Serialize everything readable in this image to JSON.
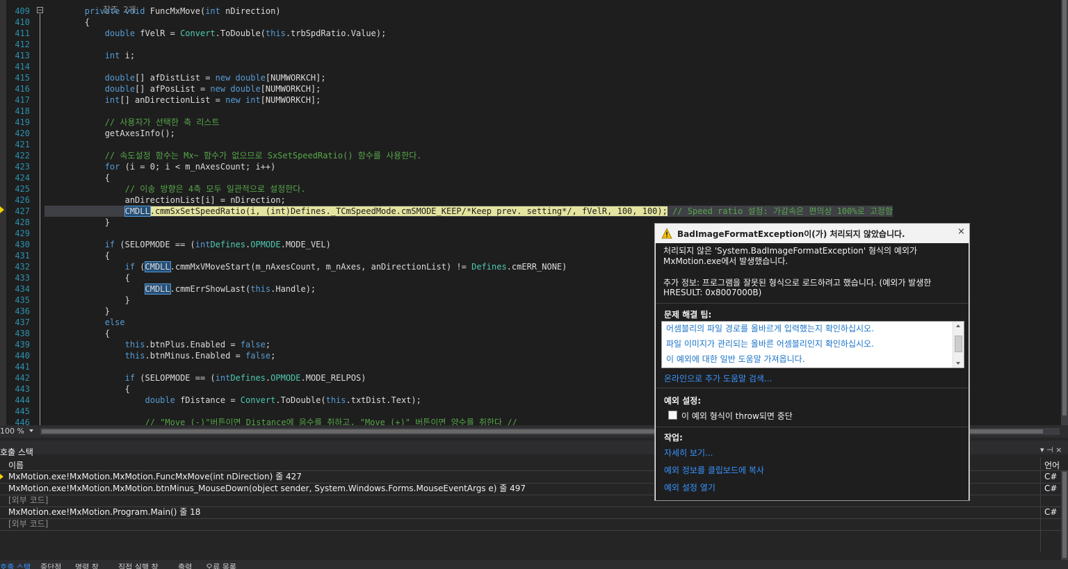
{
  "editor": {
    "lines": [
      {
        "num": "409",
        "segs": [
          [
            "kw",
            "        private void "
          ],
          [
            "",
            "FuncMxMove("
          ],
          [
            "kw",
            "int"
          ],
          [
            "",
            " nDirection)"
          ]
        ]
      },
      {
        "num": "410",
        "segs": [
          [
            "",
            "        {"
          ]
        ]
      },
      {
        "num": "411",
        "segs": [
          [
            "kw",
            "            double"
          ],
          [
            "",
            " fVelR = "
          ],
          [
            "ty",
            "Convert"
          ],
          [
            "",
            ".ToDouble("
          ],
          [
            "kw",
            "this"
          ],
          [
            "",
            ".trbSpdRatio.Value);"
          ]
        ]
      },
      {
        "num": "412",
        "segs": []
      },
      {
        "num": "413",
        "segs": [
          [
            "kw",
            "            int"
          ],
          [
            "",
            " i;"
          ]
        ]
      },
      {
        "num": "414",
        "segs": []
      },
      {
        "num": "415",
        "segs": [
          [
            "kw",
            "            double"
          ],
          [
            "",
            "[] afDistList = "
          ],
          [
            "kw",
            "new double"
          ],
          [
            "",
            "[NUMWORKCH];"
          ]
        ]
      },
      {
        "num": "416",
        "segs": [
          [
            "kw",
            "            double"
          ],
          [
            "",
            "[] afPosList = "
          ],
          [
            "kw",
            "new double"
          ],
          [
            "",
            "[NUMWORKCH];"
          ]
        ]
      },
      {
        "num": "417",
        "segs": [
          [
            "kw",
            "            int"
          ],
          [
            "",
            "[] anDirectionList = "
          ],
          [
            "kw",
            "new int"
          ],
          [
            "",
            "[NUMWORKCH];"
          ]
        ]
      },
      {
        "num": "418",
        "segs": []
      },
      {
        "num": "419",
        "segs": [
          [
            "cm",
            "            // 사용자가 선택한 축 리스트"
          ]
        ]
      },
      {
        "num": "420",
        "segs": [
          [
            "",
            "            getAxesInfo();"
          ]
        ]
      },
      {
        "num": "421",
        "segs": []
      },
      {
        "num": "422",
        "segs": [
          [
            "cm",
            "            // 속도설정 함수는 Mx~ 함수가 없으므로 SxSetSpeedRatio() 함수를 사용한다."
          ]
        ]
      },
      {
        "num": "423",
        "segs": [
          [
            "kw",
            "            for"
          ],
          [
            "",
            " (i = 0; i < m_nAxesCount; i++)"
          ]
        ]
      },
      {
        "num": "424",
        "segs": [
          [
            "",
            "            {"
          ]
        ]
      },
      {
        "num": "425",
        "segs": [
          [
            "cm",
            "                // 이송 방향은 4축 모두 일관적으로 설정한다."
          ]
        ]
      },
      {
        "num": "426",
        "segs": [
          [
            "",
            "                anDirectionList[i] = nDirection;"
          ]
        ]
      },
      {
        "num": "427",
        "segs": [
          [
            "",
            "                "
          ],
          [
            "sel",
            "CMDLL"
          ],
          [
            "hl",
            ".cmmSxSetSpeedRatio(i, (int)Defines._TCmSpeedMode.cmSMODE_KEEP/*Keep prev. setting*/, fVelR, 100, 100);"
          ],
          [
            "cm",
            " // Speed ratio 설정: 가감속은 편의상 100%로 고정함"
          ]
        ],
        "current": true
      },
      {
        "num": "428",
        "segs": [
          [
            "",
            "            }"
          ]
        ]
      },
      {
        "num": "429",
        "segs": []
      },
      {
        "num": "430",
        "segs": [
          [
            "kw",
            "            if"
          ],
          [
            "",
            " (SELOPMODE == ("
          ],
          [
            "kw",
            "int"
          ],
          [
            ")"
          ],
          [
            "ty",
            "Defines"
          ],
          [
            "",
            "."
          ],
          [
            "ty",
            "OPMODE"
          ],
          [
            "",
            ".MODE_VEL)"
          ]
        ]
      },
      {
        "num": "431",
        "segs": [
          [
            "",
            "            {"
          ]
        ]
      },
      {
        "num": "432",
        "segs": [
          [
            "kw",
            "                if"
          ],
          [
            "",
            " ("
          ],
          [
            "sel",
            "CMDLL"
          ],
          [
            "",
            ".cmmMxVMoveStart(m_nAxesCount, m_nAxes, anDirectionList) != "
          ],
          [
            "ty",
            "Defines"
          ],
          [
            "",
            ".cmERR_NONE)"
          ]
        ]
      },
      {
        "num": "433",
        "segs": [
          [
            "",
            "                {"
          ]
        ]
      },
      {
        "num": "434",
        "segs": [
          [
            "",
            "                    "
          ],
          [
            "sel",
            "CMDLL"
          ],
          [
            "",
            ".cmmErrShowLast("
          ],
          [
            "kw",
            "this"
          ],
          [
            "",
            ".Handle);"
          ]
        ]
      },
      {
        "num": "435",
        "segs": [
          [
            "",
            "                }"
          ]
        ]
      },
      {
        "num": "436",
        "segs": [
          [
            "",
            "            }"
          ]
        ]
      },
      {
        "num": "437",
        "segs": [
          [
            "kw",
            "            else"
          ]
        ]
      },
      {
        "num": "438",
        "segs": [
          [
            "",
            "            {"
          ]
        ]
      },
      {
        "num": "439",
        "segs": [
          [
            "kw",
            "                this"
          ],
          [
            "",
            ".btnPlus.Enabled = "
          ],
          [
            "kw",
            "false"
          ],
          [
            "",
            ";"
          ]
        ]
      },
      {
        "num": "440",
        "segs": [
          [
            "kw",
            "                this"
          ],
          [
            "",
            ".btnMinus.Enabled = "
          ],
          [
            "kw",
            "false"
          ],
          [
            "",
            ";"
          ]
        ]
      },
      {
        "num": "441",
        "segs": []
      },
      {
        "num": "442",
        "segs": [
          [
            "kw",
            "                if"
          ],
          [
            "",
            " (SELOPMODE == ("
          ],
          [
            "kw",
            "int"
          ],
          [
            ")"
          ],
          [
            "ty",
            "Defines"
          ],
          [
            "",
            "."
          ],
          [
            "ty",
            "OPMODE"
          ],
          [
            "",
            ".MODE_RELPOS)"
          ]
        ]
      },
      {
        "num": "443",
        "segs": [
          [
            "",
            "                {"
          ]
        ]
      },
      {
        "num": "444",
        "segs": [
          [
            "kw",
            "                    double"
          ],
          [
            "",
            " fDistance = "
          ],
          [
            "ty",
            "Convert"
          ],
          [
            "",
            ".ToDouble("
          ],
          [
            "kw",
            "this"
          ],
          [
            "",
            ".txtDist.Text);"
          ]
        ]
      },
      {
        "num": "445",
        "segs": []
      },
      {
        "num": "446",
        "segs": [
          [
            "cm",
            "                    // \"Move (-)\"버튼이면 Distance에 음수를 취하고, \"Move (+)\" 버튼이면 양수를 취한다 //"
          ]
        ]
      }
    ],
    "top_partial_comment": "참조 2개"
  },
  "zoom": {
    "level": "100 %"
  },
  "callstack": {
    "title": "호출 스택",
    "col_name": "이름",
    "col_lang": "언어",
    "pin_icons": "▾ ⊣ ×",
    "rows": [
      {
        "name": "MxMotion.exe!MxMotion.MxMotion.FuncMxMove(int nDirection) 줄 427",
        "lang": "C#",
        "external": false
      },
      {
        "name": "MxMotion.exe!MxMotion.MxMotion.btnMinus_MouseDown(object sender, System.Windows.Forms.MouseEventArgs e) 줄 497",
        "lang": "C#",
        "external": false
      },
      {
        "name": "[외부 코드]",
        "lang": "",
        "external": true
      },
      {
        "name": "MxMotion.exe!MxMotion.Program.Main() 줄 18",
        "lang": "C#",
        "external": false
      },
      {
        "name": "[외부 코드]",
        "lang": "",
        "external": true
      }
    ]
  },
  "bottom_tabs": [
    {
      "label": "호출 스택",
      "active": true
    },
    {
      "label": "중단점",
      "active": false
    },
    {
      "label": "명령 창",
      "active": false
    },
    {
      "label": "직접 실행 창",
      "active": false
    },
    {
      "label": "출력",
      "active": false
    },
    {
      "label": "오류 목록",
      "active": false
    }
  ],
  "exception": {
    "title": "BadImageFormatException이(가) 처리되지 않았습니다.",
    "close": "×",
    "message_line1": "처리되지 않은 'System.BadImageFormatException' 형식의 예외가",
    "message_line2": "MxMotion.exe에서 발생했습니다.",
    "extra_line1": "추가 정보: 프로그램을 잘못된 형식으로 로드하려고 했습니다. (예외가 발생한",
    "extra_line2": "HRESULT: 0x8007000B)",
    "tips_heading": "문제 해결 팁:",
    "tips": [
      "어셈블리의 파일 경로를 올바르게 입력했는지 확인하십시오.",
      "파일 이미지가 관리되는 올바른 어셈블리인지 확인하십시오.",
      "이 예외에 대한 일반 도움말 가져옵니다."
    ],
    "online_help": "온라인으로 추가 도움말 검색...",
    "settings_heading": "예외 설정:",
    "break_checkbox": "이 예외 형식이 throw되면 중단",
    "actions_heading": "작업:",
    "actions": [
      "자세히 보기...",
      "예외 정보를 클립보드에 복사",
      "예외 설정 열기"
    ]
  },
  "colors": {
    "keyword": "#569cd6",
    "type": "#4ec9b0",
    "comment": "#57a64a",
    "link": "#3794ff"
  }
}
